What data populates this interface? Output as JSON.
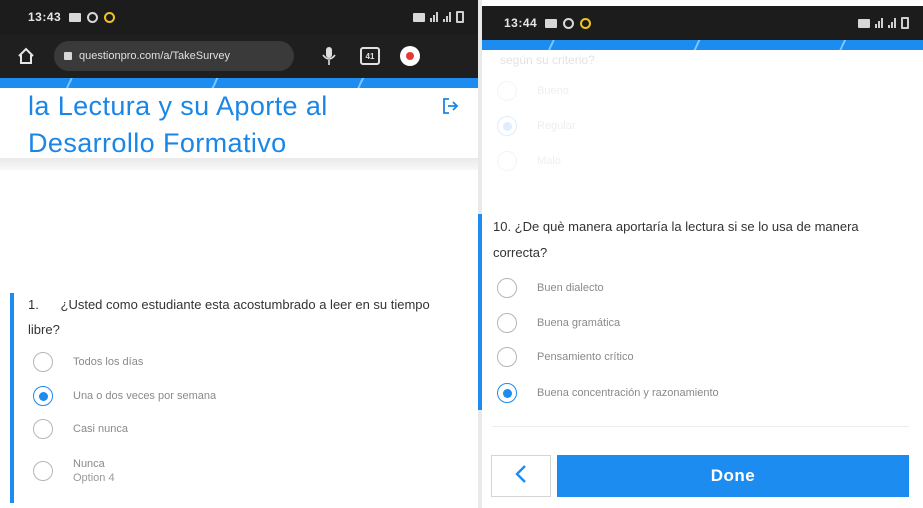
{
  "left_screen": {
    "status_bar": {
      "time": "13:43"
    },
    "browser": {
      "url": "questionpro.com/a/TakeSurvey",
      "tab_count": "41"
    },
    "survey_title": "la Lectura y su Aporte al Desarrollo Formativo",
    "question": {
      "number": "1.",
      "text": "¿Usted como estudiante esta acostumbrado a leer en su tiempo libre?",
      "options": [
        {
          "label": "Todos los días",
          "selected": false
        },
        {
          "label": "Una o dos veces por semana",
          "selected": true
        },
        {
          "label": "Casi nunca",
          "selected": false
        },
        {
          "label": "Nunca",
          "sub_label": "Option 4",
          "selected": false
        }
      ]
    }
  },
  "right_screen": {
    "status_bar": {
      "time": "13:44"
    },
    "previous_question": {
      "text_fragment": "según su criterio?",
      "options": [
        {
          "label": "Bueno",
          "selected": false
        },
        {
          "label": "Regular",
          "selected": true
        },
        {
          "label": "Malo",
          "selected": false
        }
      ]
    },
    "question": {
      "text": "10. ¿De què manera aportaría la lectura si se lo usa de manera correcta?",
      "options": [
        {
          "label": "Buen dialecto",
          "selected": false
        },
        {
          "label": "Buena gramática",
          "selected": false
        },
        {
          "label": "Pensamiento crítico",
          "selected": false
        },
        {
          "label": "Buena concentración y razonamiento",
          "selected": true
        }
      ]
    },
    "back_icon": "chevron-left-icon",
    "done_label": "Done"
  },
  "colors": {
    "accent": "#1d8cf0",
    "title": "#1a86e6",
    "status_bar": "#1c1c1c"
  }
}
